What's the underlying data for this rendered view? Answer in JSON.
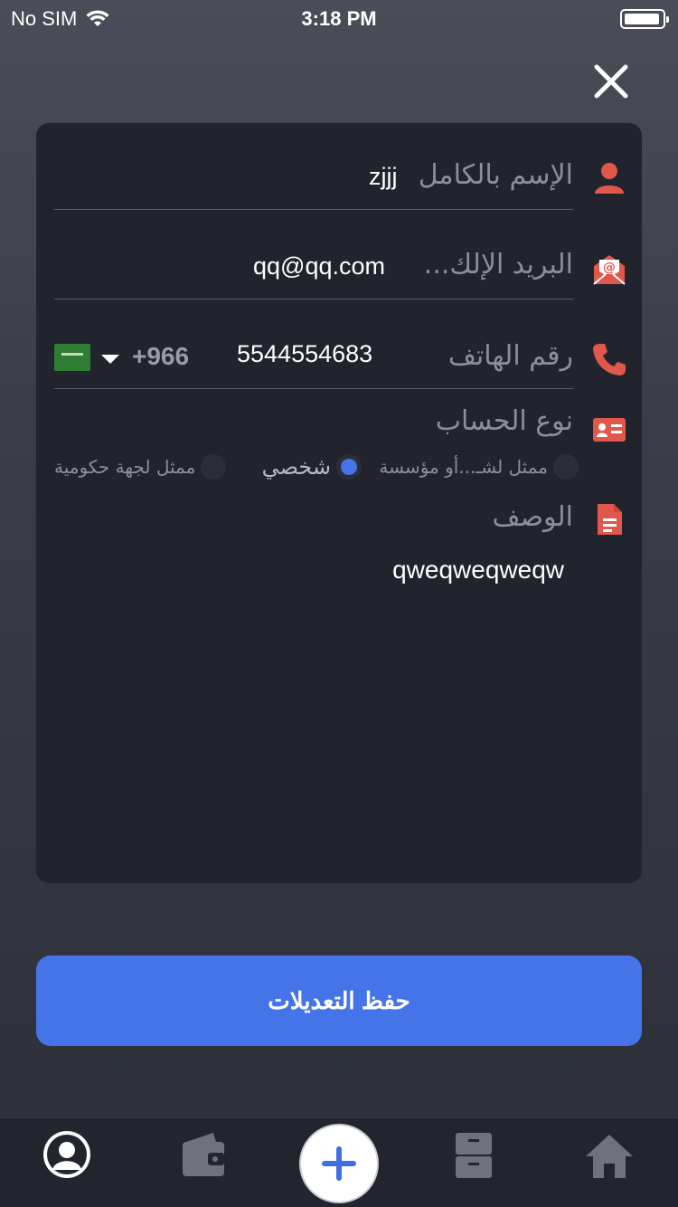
{
  "status": {
    "carrier": "No SIM",
    "time": "3:18 PM"
  },
  "icons": {
    "close": "close-icon",
    "user": "user-icon",
    "email": "envelope-at-icon",
    "phone": "phone-icon",
    "account_type": "id-card-icon",
    "description": "document-icon"
  },
  "form": {
    "full_name": {
      "label": "الإسم بالكامل",
      "value": "zjjj"
    },
    "email": {
      "label": "البريد الإلك...",
      "value": "qq@qq.com"
    },
    "phone": {
      "label": "رقم الهاتف",
      "value": "5544554683",
      "dial_code": "+966"
    },
    "account_type": {
      "label": "نوع الحساب",
      "options": [
        {
          "label": "ممثل لشـ...أو مؤسسة",
          "checked": false
        },
        {
          "label": "شخصي",
          "checked": true
        },
        {
          "label": "ممثل لجهة حكومية",
          "checked": false
        }
      ]
    },
    "description": {
      "label": "الوصف",
      "value": "qweqweqweqw"
    }
  },
  "save_button": {
    "label": "حفظ التعديلات"
  },
  "colors": {
    "accent": "#4574e8",
    "icon": "#e0584c",
    "card": "#21232d"
  },
  "tabbar": [
    "profile-icon",
    "wallet-icon",
    "add-icon",
    "archive-icon",
    "home-icon"
  ]
}
